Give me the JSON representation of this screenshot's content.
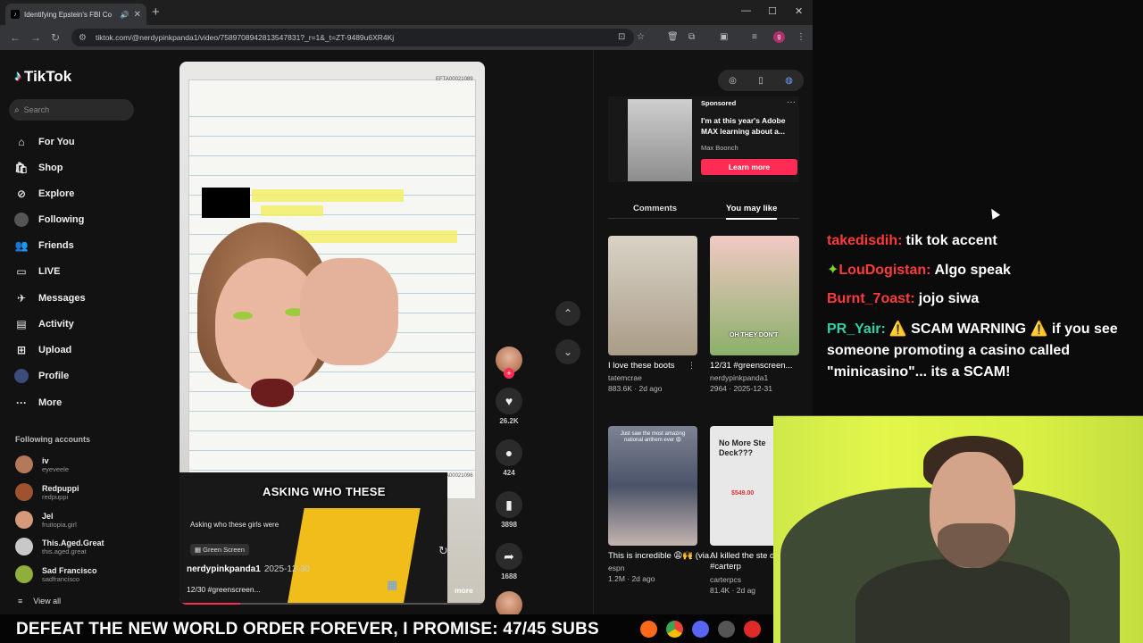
{
  "browser": {
    "tab_title": "Identifying Epstein's FBI Co",
    "url": "tiktok.com/@nerdypinkpanda1/video/7589708942813547831?_r=1&_t=ZT-9489u6XR4Kj"
  },
  "tiktok": {
    "logo": "TikTok",
    "search_placeholder": "Search",
    "nav": [
      {
        "label": "For You",
        "icon": "home-icon"
      },
      {
        "label": "Shop",
        "icon": "shop-icon"
      },
      {
        "label": "Explore",
        "icon": "compass-icon"
      },
      {
        "label": "Following",
        "icon": "following-icon"
      },
      {
        "label": "Friends",
        "icon": "friends-icon"
      },
      {
        "label": "LIVE",
        "icon": "live-icon"
      },
      {
        "label": "Messages",
        "icon": "messages-icon"
      },
      {
        "label": "Activity",
        "icon": "activity-icon"
      },
      {
        "label": "Upload",
        "icon": "upload-icon"
      },
      {
        "label": "Profile",
        "icon": "profile-icon"
      },
      {
        "label": "More",
        "icon": "more-icon"
      }
    ],
    "following_title": "Following accounts",
    "accounts": [
      {
        "name": "iv",
        "handle": "eyeveele"
      },
      {
        "name": "Redpuppi",
        "handle": "redpuppi"
      },
      {
        "name": "Jel",
        "handle": "fruitopia.girl"
      },
      {
        "name": "This.Aged.Great",
        "handle": "this.aged.great"
      },
      {
        "name": "Sad Francisco",
        "handle": "sadfrancisco"
      }
    ],
    "view_all": "View all"
  },
  "video": {
    "doc_id_top": "EFTA00021089",
    "doc_id_bottom": "EFTA00021096",
    "caption_overlay": "ASKING WHO THESE",
    "subtitle": "Asking who these girls were",
    "greenscreen_label": "Green Screen",
    "author": "nerdypinkpanda1",
    "date": "2025-12-30",
    "description": "12/30 #greenscreen...",
    "more_label": "more",
    "progress_fraction": 0.2
  },
  "actions": {
    "likes": "26.2K",
    "comments": "424",
    "saves": "3898",
    "shares": "1688"
  },
  "ad": {
    "sponsored": "Sponsored",
    "title": "I'm at this year's Adobe MAX learning about a...",
    "by": "Max Boonch",
    "cta": "Learn more"
  },
  "right_tabs": {
    "comments": "Comments",
    "you_may_like": "You may like"
  },
  "cards": [
    {
      "title": "I love these boots",
      "user": "tatemcrae",
      "stats": "883.6K · 2d ago"
    },
    {
      "title": "12/31 #greenscreen...",
      "user": "nerdypinkpanda1",
      "stats": "2964 · 2025-12-31"
    },
    {
      "title": "This is incredible 😩🙌 (via...",
      "user": "espn",
      "stats": "1.2M · 2d ago"
    },
    {
      "title": "AI killed the ste deck.. #carterp",
      "user": "carterpcs",
      "stats": "81.4K · 2d ag"
    }
  ],
  "card_overlays": {
    "c2": "OH THEY DON'T",
    "c3": "Just saw the most amazing national anthem ever 😩",
    "c4": "No More Ste Deck???",
    "c4_price": "$549.00"
  },
  "chat": [
    {
      "user": "takedisdih:",
      "color": "#ff3b3b",
      "msg": "tik tok accent"
    },
    {
      "user": "LouDogistan:",
      "color": "#ff3b3b",
      "msg": "Algo speak"
    },
    {
      "user": "Burnt_7oast:",
      "color": "#ff3b3b",
      "msg": "jojo siwa"
    },
    {
      "user": "PR_Yair:",
      "color": "#2fd2a8",
      "msg": "⚠️ SCAM WARNING ⚠️  if you see someone promoting a casino called \"minicasino\"... its a SCAM!"
    }
  ],
  "marquee": "DEFEAT THE NEW WORLD ORDER FOREVER, I PROMISE: 47/45 SUBS"
}
